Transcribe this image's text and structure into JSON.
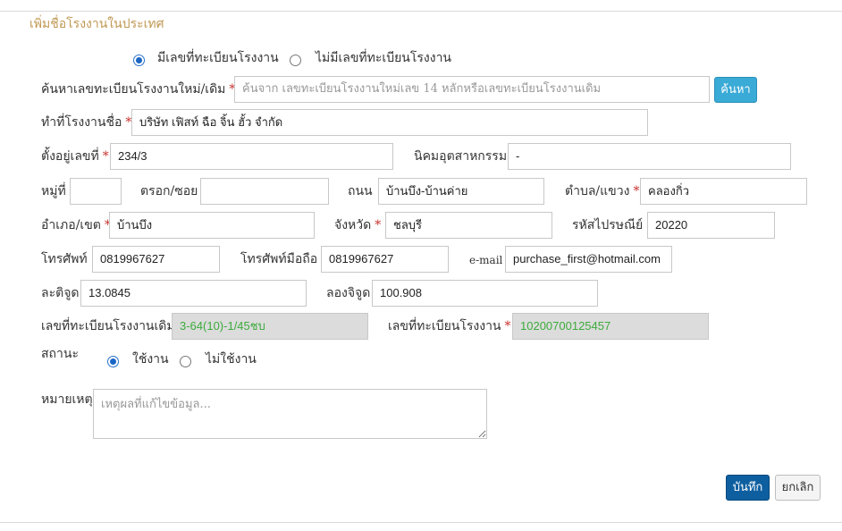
{
  "section_title": "เพิ่มชื่อโรงงานในประเทศ",
  "registration_mode": {
    "options": [
      "มีเลขที่ทะเบียนโรงงาน",
      "ไม่มีเลขที่ทะเบียนโรงงาน"
    ],
    "selected": "มีเลขที่ทะเบียนโรงงาน"
  },
  "search": {
    "label": "ค้นหาเลขทะเบียนโรงงานใหม่/เดิม",
    "placeholder": "ค้นจาก เลขทะเบียนโรงงานใหม่เลข 14 หลักหรือเลขทะเบียนโรงงานเดิม",
    "value": "",
    "button_label": "ค้นหา"
  },
  "factory_name": {
    "label": "ทำที่โรงงานชื่อ",
    "value": "บริษัท เฟิสท์ ฉือ จิ้น ฮั้ว จำกัด"
  },
  "address": {
    "number": {
      "label": "ตั้งอยู่เลขที่",
      "value": "234/3"
    },
    "estate": {
      "label": "นิคมอุตสาหกรรม",
      "value": "-"
    },
    "moo": {
      "label": "หมู่ที่",
      "value": ""
    },
    "soi": {
      "label": "ตรอก/ซอย",
      "value": ""
    },
    "road": {
      "label": "ถนน",
      "value": "บ้านบึง-บ้านค่าย"
    },
    "subdistrict": {
      "label": "ตำบล/แขวง",
      "value": "คลองกิ่ว"
    },
    "district": {
      "label": "อำเภอ/เขต",
      "value": "บ้านบึง"
    },
    "province": {
      "label": "จังหวัด",
      "value": "ชลบุรี"
    },
    "postcode": {
      "label": "รหัสไปรษณีย์",
      "value": "20220"
    }
  },
  "contact": {
    "phone": {
      "label": "โทรศัพท์",
      "value": "0819967627"
    },
    "mobile": {
      "label": "โทรศัพท์มือถือ",
      "value": "0819967627"
    },
    "email": {
      "label": "e-mail",
      "value": "purchase_first@hotmail.com"
    }
  },
  "geo": {
    "latitude": {
      "label": "ละติจูด",
      "value": "13.0845"
    },
    "longitude": {
      "label": "ลองจิจูด",
      "value": "100.908"
    }
  },
  "registration": {
    "old_number": {
      "label": "เลขที่ทะเบียนโรงงานเดิม",
      "value": "3-64(10)-1/45ชบ"
    },
    "new_number": {
      "label": "เลขที่ทะเบียนโรงงาน",
      "value": "10200700125457"
    }
  },
  "status": {
    "label": "สถานะ",
    "options": [
      "ใช้งาน",
      "ไม่ใช้งาน"
    ],
    "selected": "ใช้งาน"
  },
  "remark": {
    "label": "หมายเหตุ",
    "placeholder": "เหตุผลที่แก้ไขข้อมูล...",
    "value": ""
  },
  "actions": {
    "save_label": "บันทึก",
    "cancel_label": "ยกเลิก"
  },
  "required_mark": "*",
  "colors": {
    "section_title": "#c09853",
    "required": "#c9302c",
    "readonly_text": "#3cab3c",
    "save_button": "#0e5fa0",
    "search_button": "#3aaad6"
  }
}
